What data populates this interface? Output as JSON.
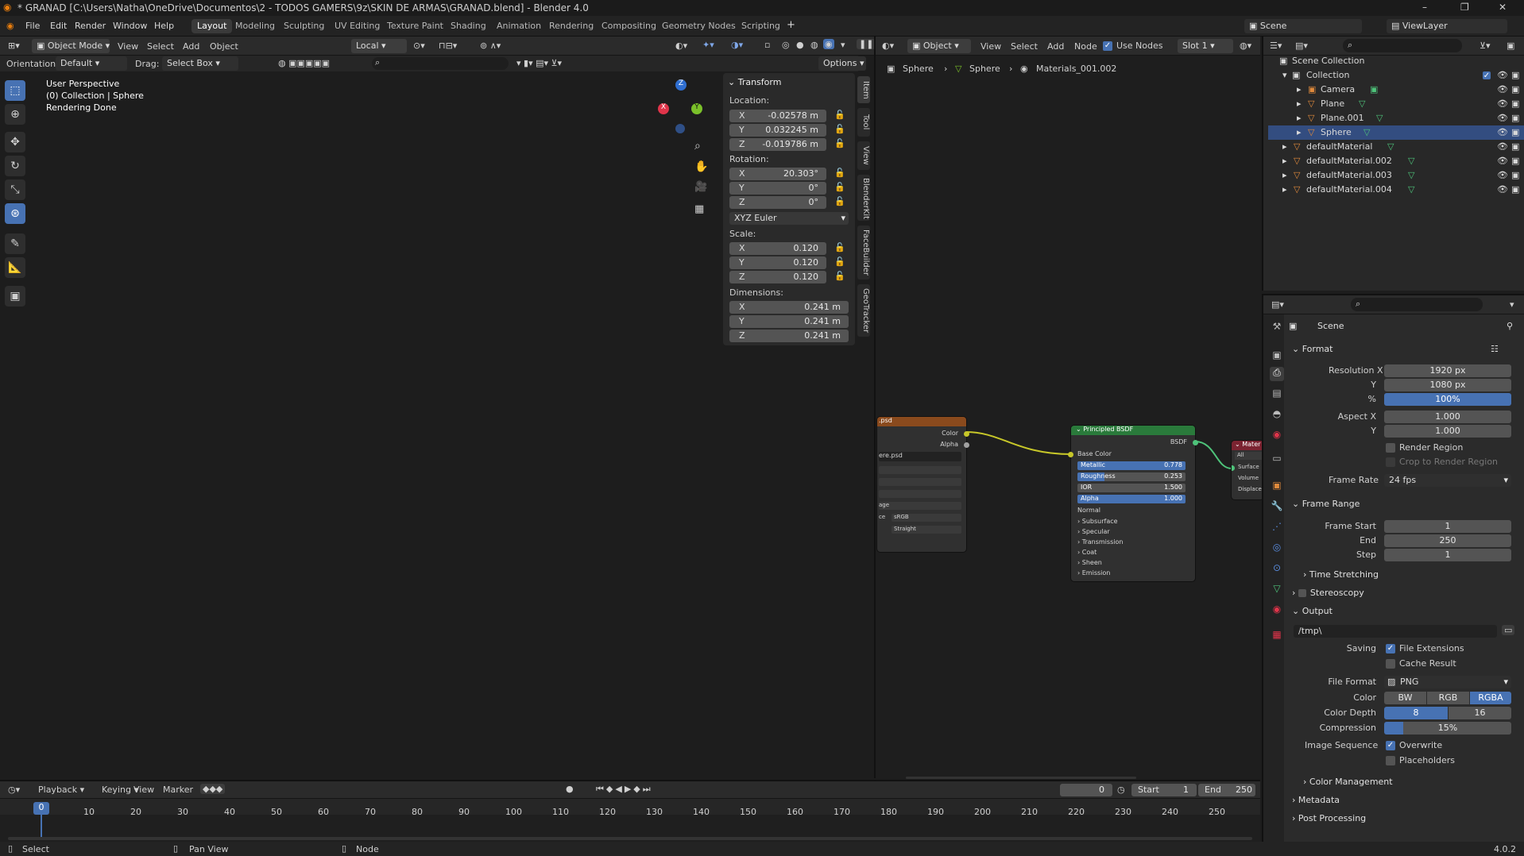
{
  "window": {
    "title": "* GRANAD [C:\\Users\\Natha\\OneDrive\\Documentos\\2 - TODOS GAMERS\\9z\\SKIN DE ARMAS\\GRANAD.blend] - Blender 4.0",
    "min": "–",
    "max": "❐",
    "close": "✕"
  },
  "menu": {
    "file": "File",
    "edit": "Edit",
    "render": "Render",
    "window": "Window",
    "help": "Help"
  },
  "workspaces": [
    "Layout",
    "Modeling",
    "Sculpting",
    "UV Editing",
    "Texture Paint",
    "Shading",
    "Animation",
    "Rendering",
    "Compositing",
    "Geometry Nodes",
    "Scripting"
  ],
  "scene_selector": "Scene",
  "viewlayer_selector": "ViewLayer",
  "viewport": {
    "mode": "Object Mode",
    "menus": [
      "View",
      "Select",
      "Add",
      "Object"
    ],
    "transform_space": "Local",
    "orientation_label": "Orientation:",
    "orientation_value": "Default",
    "drag_label": "Drag:",
    "drag_value": "Select Box",
    "options": "Options",
    "overlay_lines": [
      "User Perspective",
      "(0) Collection | Sphere",
      "Rendering Done"
    ],
    "gizmo": {
      "x": "X",
      "y": "Y",
      "z": "Z"
    }
  },
  "transform": {
    "title": "Transform",
    "location_label": "Location:",
    "rotation_label": "Rotation:",
    "scale_label": "Scale:",
    "dimensions_label": "Dimensions:",
    "location": [
      {
        "axis": "X",
        "value": "-0.02578 m"
      },
      {
        "axis": "Y",
        "value": "0.032245 m"
      },
      {
        "axis": "Z",
        "value": "-0.019786 m"
      }
    ],
    "rotation": [
      {
        "axis": "X",
        "value": "20.303°"
      },
      {
        "axis": "Y",
        "value": "0°"
      },
      {
        "axis": "Z",
        "value": "0°"
      }
    ],
    "rotation_mode": "XYZ Euler",
    "scale": [
      {
        "axis": "X",
        "value": "0.120"
      },
      {
        "axis": "Y",
        "value": "0.120"
      },
      {
        "axis": "Z",
        "value": "0.120"
      }
    ],
    "dimensions": [
      {
        "axis": "X",
        "value": "0.241 m"
      },
      {
        "axis": "Y",
        "value": "0.241 m"
      },
      {
        "axis": "Z",
        "value": "0.241 m"
      }
    ]
  },
  "side_tabs": [
    "Item",
    "Tool",
    "View",
    "BlenderKit",
    "FaceBuilder",
    "GeoTracker"
  ],
  "node_editor": {
    "type": "Object",
    "menus": [
      "View",
      "Select",
      "Add",
      "Node"
    ],
    "use_nodes": "Use Nodes",
    "slot": "Slot 1",
    "breadcrumb": [
      "Sphere",
      "Sphere",
      "Materials_001.002"
    ],
    "image_node": {
      "title": ".psd",
      "out_color": "Color",
      "out_alpha": "Alpha",
      "image": "ere.psd",
      "projection": "age",
      "colorspace_label": "ce",
      "colorspace": "sRGB",
      "alpha": "Straight"
    },
    "bsdf": {
      "title": "Principled BSDF",
      "out": "BSDF",
      "base_color": "Base Color",
      "params": [
        {
          "name": "Metallic",
          "value": "0.778"
        },
        {
          "name": "Roughness",
          "value": "0.253"
        },
        {
          "name": "IOR",
          "value": "1.500"
        },
        {
          "name": "Alpha",
          "value": "1.000"
        }
      ],
      "normal": "Normal",
      "groups": [
        "Subsurface",
        "Specular",
        "Transmission",
        "Coat",
        "Sheen",
        "Emission"
      ]
    },
    "output_node": {
      "title": "Mater",
      "target": "All",
      "sockets": [
        "Surface",
        "Volume",
        "Displacem"
      ]
    }
  },
  "outliner": {
    "root": "Scene Collection",
    "collection": "Collection",
    "items": [
      "Camera",
      "Plane",
      "Plane.001",
      "Sphere"
    ],
    "materials": [
      "defaultMaterial",
      "defaultMaterial.002",
      "defaultMaterial.003",
      "defaultMaterial.004"
    ]
  },
  "properties": {
    "context": "Scene",
    "format": {
      "title": "Format",
      "res_x_label": "Resolution X",
      "res_x": "1920 px",
      "res_y_label": "Y",
      "res_y": "1080 px",
      "pct_label": "%",
      "pct": "100%",
      "aspect_x_label": "Aspect X",
      "aspect_x": "1.000",
      "aspect_y_label": "Y",
      "aspect_y": "1.000",
      "render_region": "Render Region",
      "crop": "Crop to Render Region",
      "frame_rate_label": "Frame Rate",
      "frame_rate": "24 fps"
    },
    "frame_range": {
      "title": "Frame Range",
      "start_label": "Frame Start",
      "start": "1",
      "end_label": "End",
      "end": "250",
      "step_label": "Step",
      "step": "1",
      "time_stretching": "Time Stretching"
    },
    "stereoscopy": "Stereoscopy",
    "output": {
      "title": "Output",
      "path": "/tmp\\",
      "saving_label": "Saving",
      "file_extensions": "File Extensions",
      "cache_result": "Cache Result",
      "file_format_label": "File Format",
      "file_format": "PNG",
      "color_label": "Color",
      "color_opts": [
        "BW",
        "RGB",
        "RGBA"
      ],
      "depth_label": "Color Depth",
      "depth_opts": [
        "8",
        "16"
      ],
      "compression_label": "Compression",
      "compression": "15%",
      "image_seq_label": "Image Sequence",
      "overwrite": "Overwrite",
      "placeholders": "Placeholders",
      "color_management": "Color Management"
    },
    "metadata": "Metadata",
    "post_processing": "Post Processing"
  },
  "timeline": {
    "menus": [
      "Playback",
      "Keying",
      "View",
      "Marker"
    ],
    "current": "0",
    "start_label": "Start",
    "start": "1",
    "end_label": "End",
    "end": "250",
    "ticks": [
      "0",
      "10",
      "20",
      "30",
      "40",
      "50",
      "60",
      "70",
      "80",
      "90",
      "100",
      "110",
      "120",
      "130",
      "140",
      "150",
      "160",
      "170",
      "180",
      "190",
      "200",
      "210",
      "220",
      "230",
      "240",
      "250"
    ]
  },
  "statusbar": {
    "select": "Select",
    "pan": "Pan View",
    "node": "Node",
    "version": "4.0.2"
  }
}
